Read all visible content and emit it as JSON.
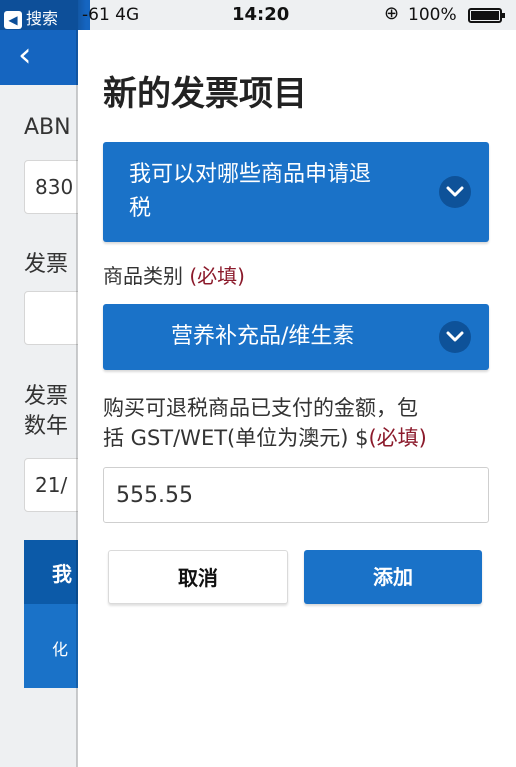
{
  "status_bar": {
    "back_app": "搜索",
    "signal": "-61  4G",
    "time": "14:20",
    "battery": "100%"
  },
  "background": {
    "back_glyph": "‹",
    "abn_label": "ABN",
    "abn_value": "830",
    "invoice_label": "发票",
    "invoice_date_label_1": "发票",
    "invoice_date_label_2": "数年",
    "date_value": "21/",
    "blue_button_text": "我",
    "blue_row_text": "化"
  },
  "modal": {
    "title": "新的发票项目",
    "goods_dropdown_line1": "我可以对哪些商品申请退",
    "goods_dropdown_line2": "税",
    "category_label": "商品类别 ",
    "category_required": "(必填)",
    "category_value": "营养补充品/维生素",
    "amount_label_line1": "购买可退税商品已支付的金额，包",
    "amount_label_line2": "括 GST/WET(单位为澳元) $",
    "amount_required": "(必填)",
    "amount_value": "555.55",
    "cancel_label": "取消",
    "add_label": "添加"
  },
  "colors": {
    "primary_blue": "#1a72c8",
    "required_red": "#8b1a2b"
  }
}
